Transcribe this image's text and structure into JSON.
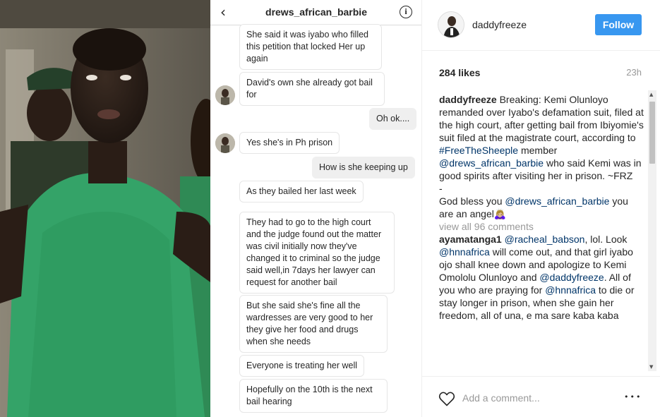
{
  "chat": {
    "title": "drews_african_barbie",
    "messages": [
      {
        "dir": "in",
        "text": "She said it was iyabo who filled this petition that locked Her up again"
      },
      {
        "dir": "in",
        "text": "David's own she already got bail for"
      },
      {
        "dir": "out",
        "text": "Oh ok...."
      },
      {
        "dir": "in",
        "text": "Yes she's in Ph prison"
      },
      {
        "dir": "out",
        "text": "How is she keeping up"
      },
      {
        "dir": "in",
        "text": "As they bailed her last week"
      },
      {
        "dir": "in",
        "text": "They had to go to the high court and the judge found out the matter was civil initially now they've changed it to criminal so the judge said well,in 7days her lawyer can request for another bail"
      },
      {
        "dir": "in",
        "text": "But she said she's fine all the wardresses are very good to her they give her food and drugs when she needs"
      },
      {
        "dir": "in",
        "text": "Everyone is treating her well"
      },
      {
        "dir": "in",
        "text": "Hopefully on the 10th is the next bail hearing"
      }
    ]
  },
  "post": {
    "username": "daddyfreeze",
    "follow_label": "Follow",
    "likes": "284 likes",
    "time": "23h",
    "caption": {
      "user": "daddyfreeze",
      "t1": " Breaking: Kemi Olunloyo remanded over Iyabo's defamation suit, filed at the high court, after getting bail from Ibiyomie's suit filed at the magistrate court, according to ",
      "tag1": "#FreeTheSheeple",
      "t2": " member ",
      "tag2": "@drews_african_barbie",
      "t3": " who said Kemi was in good spirits after visiting her in prison. ~FRZ",
      "dash": "-",
      "t4": "God bless you ",
      "tag3": "@drews_african_barbie",
      "t5": " you are an angel🙇🏼‍♀️"
    },
    "view_all": "view all 96 comments",
    "comment1": {
      "user": "ayamatanga1",
      "sp": " ",
      "tag1": "@racheal_babson",
      "t1": ", lol. Look ",
      "tag2": "@hnnafrica",
      "t2": " will come out, and that girl iyabo ojo shall knee down and apologize to Kemi Omololu Olunloyo and ",
      "tag3": "@daddyfreeze",
      "t3": ". All of you who are praying for ",
      "tag4": "@hnnafrica",
      "t4": " to die or stay longer in prison, when she gain her freedom, all of una, e ma sare kaba kaba"
    },
    "add_comment_placeholder": "Add a comment...",
    "more_label": "•••",
    "icons": {
      "heart": "heart-icon",
      "more": "more-options-icon"
    },
    "colors": {
      "follow_bg": "#3897f0",
      "tag": "#003569",
      "muted": "#999999"
    }
  }
}
